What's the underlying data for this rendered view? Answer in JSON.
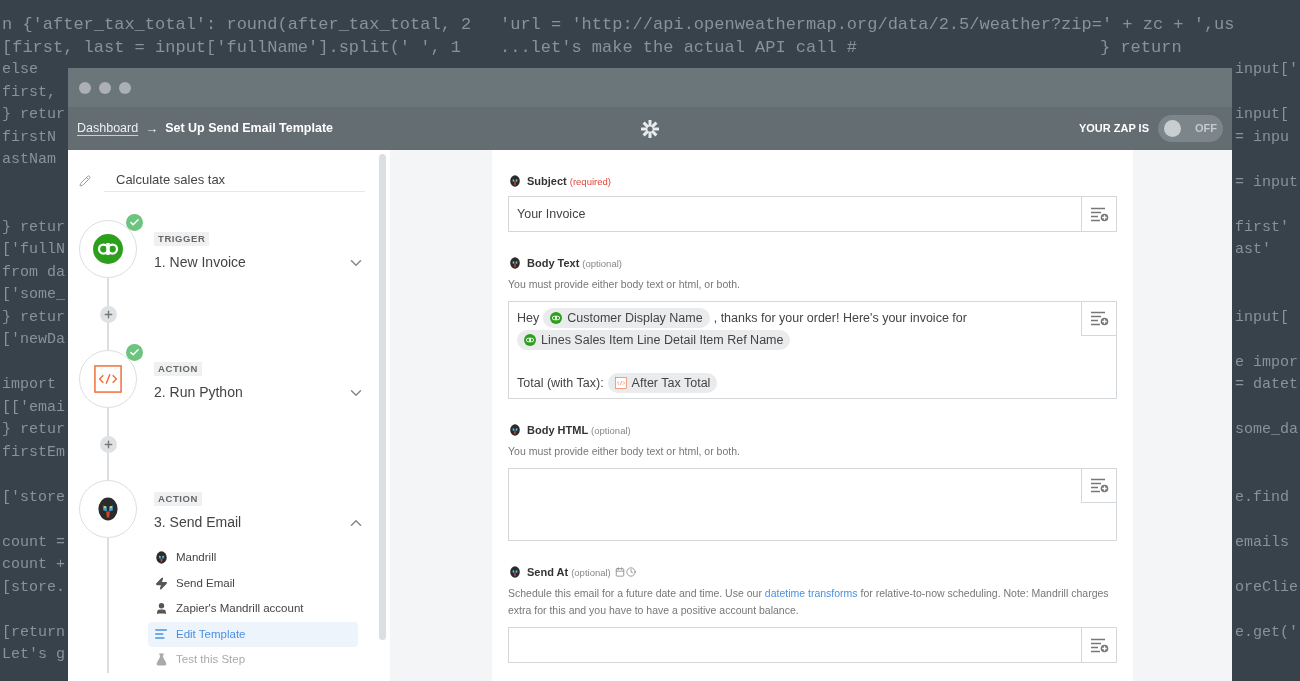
{
  "background_code": {
    "lines": [
      {
        "left": "n {'after_tax_total': round(after_tax_total, 2",
        "middle": "'url = 'http://api.openweathermap.org/data/2.5/weather?zip=' + zc + ',us"
      },
      {
        "left": "[first, last = input['fullName'].split(' ', 1",
        "middle": "...let's make the actual API call #",
        "right": "} return"
      },
      {
        "left": "else",
        "edge": "input['"
      },
      {
        "left": "first,"
      },
      {
        "left": "} retur",
        "edge": "input["
      },
      {
        "left": "firstN",
        "edge": "= inpu"
      },
      {
        "left": "astNam"
      },
      {
        "edge": "= input"
      },
      {
        "left": "} retur",
        "edge": "first'",
        "gap_before": true
      },
      {
        "left": "['fullN",
        "edge": "ast'"
      },
      {
        "left": "from da"
      },
      {
        "left": "['some_"
      },
      {
        "left": "} retur",
        "edge": "input["
      },
      {
        "left": "['newDa"
      },
      {
        "edge": "e impor"
      },
      {
        "left": "import",
        "edge": "= datet"
      },
      {
        "left": "[['emai"
      },
      {
        "left": "} retur",
        "edge": "some_da"
      },
      {
        "left": "firstEm"
      },
      {
        "left": "['store",
        "edge": "e.find",
        "gap_before": true
      },
      {
        "left": "count =",
        "edge": "emails",
        "gap_before": true
      },
      {
        "left": "count +"
      },
      {
        "left": "[store.",
        "edge": "oreClie"
      },
      {
        "left": "[return",
        "edge": "e.get('",
        "gap_before": true
      },
      {
        "left": "Let's g"
      }
    ]
  },
  "window": {
    "breadcrumb": {
      "link": "Dashboard",
      "separator": "→",
      "current": "Set Up Send Email Template"
    },
    "zap_status": {
      "label": "YOUR ZAP IS",
      "toggle": {
        "on": false,
        "text": "OFF"
      }
    }
  },
  "sidebar": {
    "zap_name": "Calculate sales tax",
    "steps": [
      {
        "kind": "quickbooks",
        "badge": "TRIGGER",
        "title": "1. New Invoice",
        "done": true,
        "expanded": false
      },
      {
        "kind": "code",
        "badge": "ACTION",
        "title": "2. Run Python",
        "done": true,
        "expanded": false
      },
      {
        "kind": "mandrill",
        "badge": "ACTION",
        "title": "3. Send Email",
        "done": false,
        "expanded": true,
        "substeps": [
          {
            "kind": "app",
            "label": "Mandrill",
            "selected": false,
            "disabled": false
          },
          {
            "kind": "action",
            "label": "Send Email",
            "selected": false,
            "disabled": false
          },
          {
            "kind": "account",
            "label": "Zapier's Mandrill account",
            "selected": false,
            "disabled": false
          },
          {
            "kind": "template",
            "label": "Edit Template",
            "selected": true,
            "disabled": false
          },
          {
            "kind": "test",
            "label": "Test this Step",
            "selected": false,
            "disabled": true
          }
        ]
      }
    ]
  },
  "form": {
    "fields": [
      {
        "kind": "single",
        "label": "Subject",
        "requirement": {
          "kind": "required",
          "text": "(required)"
        },
        "datetime": false,
        "value": "Your Invoice"
      },
      {
        "kind": "multi",
        "label": "Body Text",
        "requirement": {
          "kind": "optional",
          "text": "(optional)"
        },
        "datetime": false,
        "help": [
          {
            "text": "You must provide either body text or html, or both."
          }
        ],
        "lines": [
          [
            {
              "kind": "text",
              "text": "Hey"
            },
            {
              "kind": "qbtoken",
              "text": "Customer Display Name"
            },
            {
              "kind": "text",
              "text": ", thanks for your order! Here's your invoice for"
            },
            {
              "kind": "qbtoken",
              "text": "Lines Sales Item Line Detail Item Ref Name"
            }
          ],
          [
            {
              "kind": "text",
              "text": "Total (with Tax):"
            },
            {
              "kind": "codetoken",
              "text": "After Tax Total"
            }
          ]
        ]
      },
      {
        "kind": "multi",
        "label": "Body HTML",
        "requirement": {
          "kind": "optional",
          "text": "(optional)"
        },
        "datetime": false,
        "help": [
          {
            "text": "You must provide either body text or html, or both."
          }
        ]
      },
      {
        "kind": "single",
        "label": "Send At",
        "requirement": {
          "kind": "optional",
          "text": "(optional)"
        },
        "datetime": true,
        "help": [
          {
            "text": "Schedule this email for a future date and time. Use our "
          },
          {
            "text": "datetime transforms",
            "link": true
          },
          {
            "text": " for relative-to-now scheduling. Note: Mandrill charges extra for this and you have to have a positive account balance."
          }
        ]
      }
    ]
  }
}
